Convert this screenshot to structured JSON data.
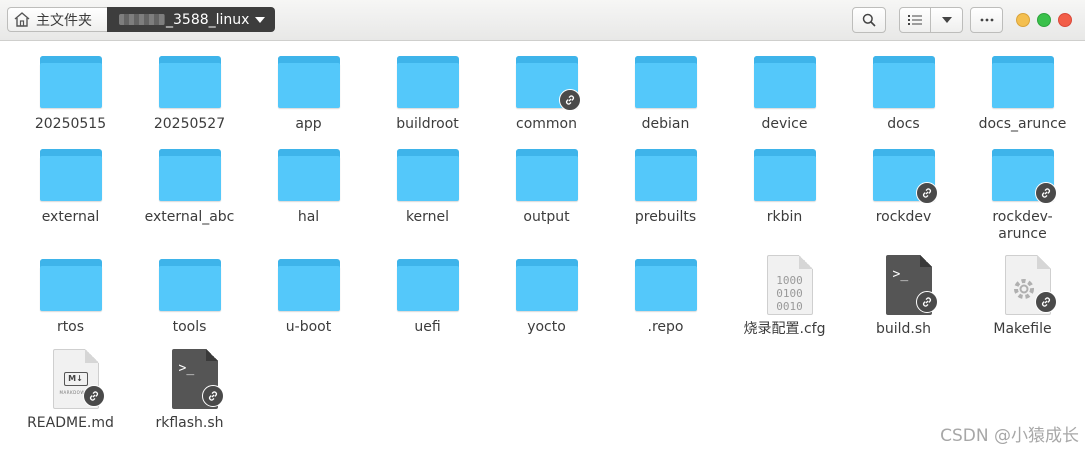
{
  "toolbar": {
    "home_label": "主文件夹",
    "current_folder": "_3588_linux"
  },
  "items": [
    {
      "label": "20250515",
      "type": "folder",
      "link": false
    },
    {
      "label": "20250527",
      "type": "folder",
      "link": false
    },
    {
      "label": "app",
      "type": "folder",
      "link": false
    },
    {
      "label": "buildroot",
      "type": "folder",
      "link": false
    },
    {
      "label": "common",
      "type": "folder",
      "link": true
    },
    {
      "label": "debian",
      "type": "folder",
      "link": false
    },
    {
      "label": "device",
      "type": "folder",
      "link": false
    },
    {
      "label": "docs",
      "type": "folder",
      "link": false
    },
    {
      "label": "docs_arunce",
      "type": "folder",
      "link": false
    },
    {
      "label": "external",
      "type": "folder",
      "link": false
    },
    {
      "label": "external_abc",
      "type": "folder",
      "link": false
    },
    {
      "label": "hal",
      "type": "folder",
      "link": false
    },
    {
      "label": "kernel",
      "type": "folder",
      "link": false
    },
    {
      "label": "output",
      "type": "folder",
      "link": false
    },
    {
      "label": "prebuilts",
      "type": "folder",
      "link": false
    },
    {
      "label": "rkbin",
      "type": "folder",
      "link": false
    },
    {
      "label": "rockdev",
      "type": "folder",
      "link": true
    },
    {
      "label": "rockdev-arunce",
      "type": "folder",
      "link": true
    },
    {
      "label": "rtos",
      "type": "folder",
      "link": false
    },
    {
      "label": "tools",
      "type": "folder",
      "link": false
    },
    {
      "label": "u-boot",
      "type": "folder",
      "link": false
    },
    {
      "label": "uefi",
      "type": "folder",
      "link": false
    },
    {
      "label": "yocto",
      "type": "folder",
      "link": false
    },
    {
      "label": ".repo",
      "type": "folder",
      "link": false
    },
    {
      "label": "烧录配置.cfg",
      "type": "binary",
      "link": false,
      "icon_text": "1000 0100 0010"
    },
    {
      "label": "build.sh",
      "type": "script",
      "link": true,
      "icon_text": ">_"
    },
    {
      "label": "Makefile",
      "type": "makefile",
      "link": true
    },
    {
      "label": "README.md",
      "type": "markdown",
      "link": true,
      "icon_text": "M↓",
      "icon_subtext": "MARKDOWN"
    },
    {
      "label": "rkflash.sh",
      "type": "script",
      "link": true,
      "icon_text": ">_"
    }
  ],
  "watermark": "CSDN @小猿成长"
}
